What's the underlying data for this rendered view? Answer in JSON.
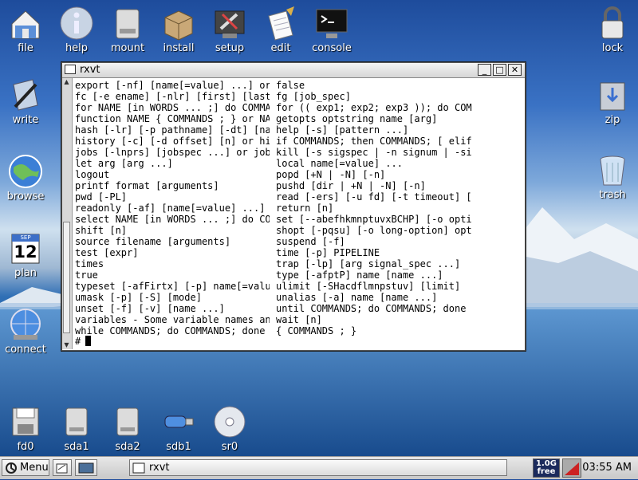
{
  "desktop": {
    "icons_top": [
      {
        "label": "file",
        "icon": "home-folder-icon"
      },
      {
        "label": "help",
        "icon": "info-icon"
      },
      {
        "label": "mount",
        "icon": "drive-icon"
      },
      {
        "label": "install",
        "icon": "package-box-icon"
      },
      {
        "label": "setup",
        "icon": "tools-icon"
      },
      {
        "label": "edit",
        "icon": "notepad-icon"
      },
      {
        "label": "console",
        "icon": "terminal-icon"
      }
    ],
    "icons_left": [
      {
        "label": "write",
        "icon": "pen-document-icon"
      },
      {
        "label": "browse",
        "icon": "globe-icon"
      },
      {
        "label": "plan",
        "icon": "calendar-icon"
      },
      {
        "label": "connect",
        "icon": "network-globe-icon"
      }
    ],
    "icons_right": [
      {
        "label": "lock",
        "icon": "padlock-icon"
      },
      {
        "label": "zip",
        "icon": "archive-icon"
      },
      {
        "label": "trash",
        "icon": "trash-icon"
      }
    ],
    "icons_bottom": [
      {
        "label": "fd0",
        "icon": "floppy-icon"
      },
      {
        "label": "sda1",
        "icon": "hard-drive-icon"
      },
      {
        "label": "sda2",
        "icon": "hard-drive-icon"
      },
      {
        "label": "sdb1",
        "icon": "usb-stick-icon"
      },
      {
        "label": "sr0",
        "icon": "cdrom-icon"
      }
    ],
    "calendar_month": "SEP",
    "calendar_day": "12"
  },
  "window": {
    "title": "rxvt",
    "left_column": [
      "export [-nf] [name[=value] ...] or",
      "fc [-e ename] [-nlr] [first] [last",
      "for NAME [in WORDS ... ;] do COMMA",
      "function NAME { COMMANDS ; } or NA",
      "hash [-lr] [-p pathname] [-dt] [na",
      "history [-c] [-d offset] [n] or hi",
      "jobs [-lnprs] [jobspec ...] or job",
      "let arg [arg ...]",
      "logout",
      "printf format [arguments]",
      "pwd [-PL]",
      "readonly [-af] [name[=value] ...]",
      "select NAME [in WORDS ... ;] do CO",
      "shift [n]",
      "source filename [arguments]",
      "test [expr]",
      "times",
      "true",
      "typeset [-afFirtx] [-p] name[=valu",
      "umask [-p] [-S] [mode]",
      "unset [-f] [-v] [name ...]",
      "variables - Some variable names an",
      "while COMMANDS; do COMMANDS; done"
    ],
    "right_column": [
      "false",
      "fg [job_spec]",
      "for (( exp1; exp2; exp3 )); do COM",
      "getopts optstring name [arg]",
      "help [-s] [pattern ...]",
      "if COMMANDS; then COMMANDS; [ elif",
      "kill [-s sigspec | -n signum | -si",
      "local name[=value] ...",
      "popd [+N | -N] [-n]",
      "pushd [dir | +N | -N] [-n]",
      "read [-ers] [-u fd] [-t timeout] [",
      "return [n]",
      "set [--abefhkmnptuvxBCHP] [-o opti",
      "shopt [-pqsu] [-o long-option] opt",
      "suspend [-f]",
      "time [-p] PIPELINE",
      "trap [-lp] [arg signal_spec ...]",
      "type [-afptP] name [name ...]",
      "ulimit [-SHacdflmnpstuv] [limit]",
      "unalias [-a] name [name ...]",
      "until COMMANDS; do COMMANDS; done",
      "wait [n]",
      "{ COMMANDS ; }"
    ],
    "prompt": "#"
  },
  "taskbar": {
    "menu_label": "Menu",
    "task_label": "rxvt",
    "free_size": "1.0G",
    "free_label": "free",
    "clock": "03:55 AM"
  }
}
